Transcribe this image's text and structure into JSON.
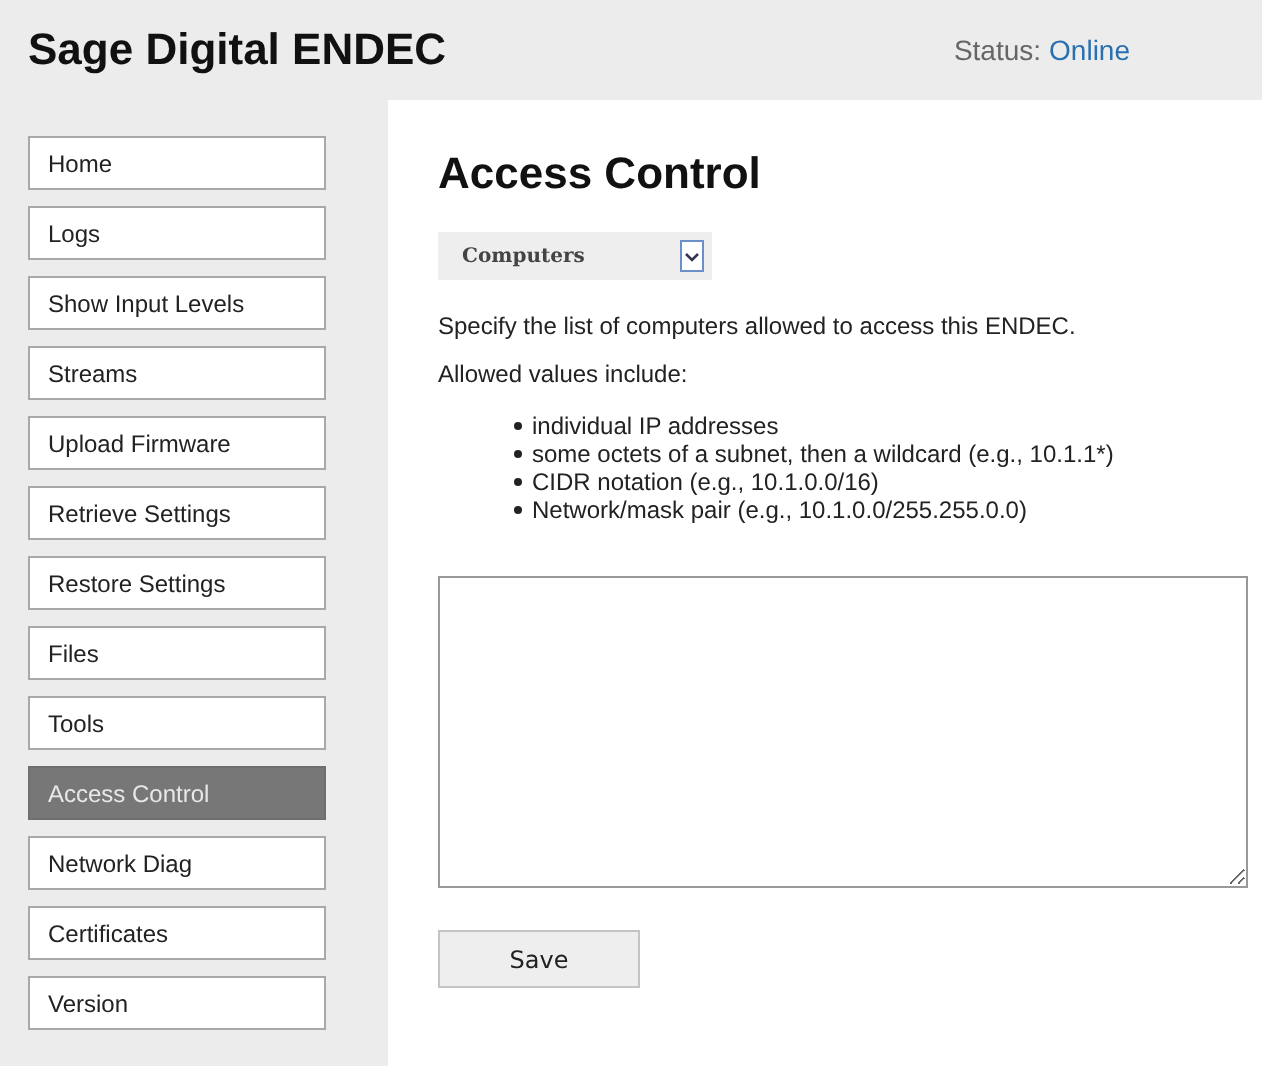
{
  "header": {
    "title": "Sage Digital ENDEC",
    "status_label": "Status:",
    "status_value": "Online"
  },
  "sidebar": {
    "items": [
      {
        "label": "Home",
        "selected": false
      },
      {
        "label": "Logs",
        "selected": false
      },
      {
        "label": "Show Input Levels",
        "selected": false
      },
      {
        "label": "Streams",
        "selected": false
      },
      {
        "label": "Upload Firmware",
        "selected": false
      },
      {
        "label": "Retrieve Settings",
        "selected": false
      },
      {
        "label": "Restore Settings",
        "selected": false
      },
      {
        "label": "Files",
        "selected": false
      },
      {
        "label": "Tools",
        "selected": false
      },
      {
        "label": "Access Control",
        "selected": true
      },
      {
        "label": "Network Diag",
        "selected": false
      },
      {
        "label": "Certificates",
        "selected": false
      },
      {
        "label": "Version",
        "selected": false
      }
    ]
  },
  "content": {
    "title": "Access Control",
    "dropdown": {
      "value": "Computers"
    },
    "description": "Specify the list of computers allowed to access this ENDEC.",
    "allowed_heading": "Allowed values include:",
    "allowed_values": [
      "individual IP addresses",
      "some octets of a subnet, then a wildcard (e.g., 10.1.1*)",
      "CIDR notation (e.g., 10.1.0.0/16)",
      "Network/mask pair (e.g., 10.1.0.0/255.255.0.0)"
    ],
    "save_button": "Save"
  }
}
